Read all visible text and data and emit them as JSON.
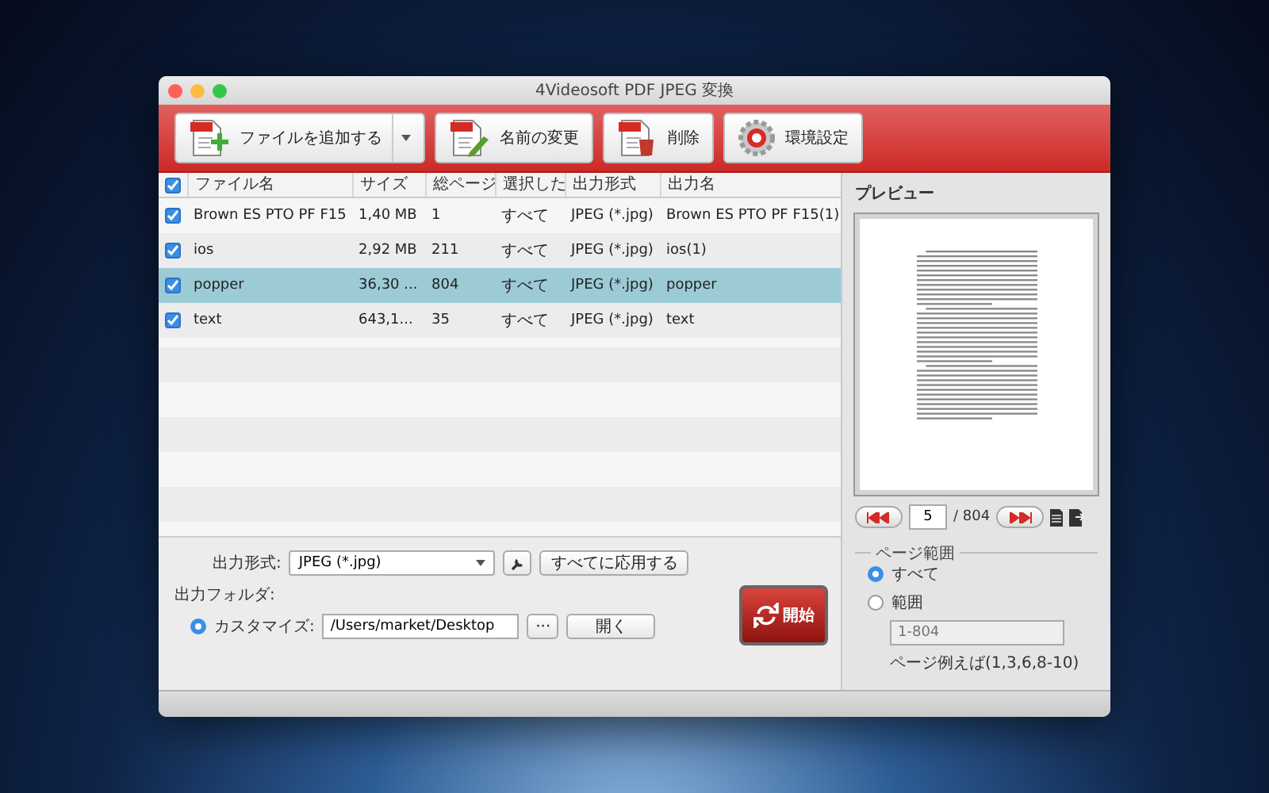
{
  "window": {
    "title": "4Videosoft PDF JPEG 変換"
  },
  "toolbar": [
    {
      "kind": "add",
      "label": "ファイルを追加する",
      "has_dropdown": true
    },
    {
      "kind": "rename",
      "label": "名前の変更",
      "has_dropdown": false
    },
    {
      "kind": "delete",
      "label": "削除",
      "has_dropdown": false
    },
    {
      "kind": "settings",
      "label": "環境設定",
      "has_dropdown": false
    }
  ],
  "table": {
    "all_checked": true,
    "columns": [
      "ファイル名",
      "サイズ",
      "総ページ",
      "選択した",
      "出力形式",
      "出力名"
    ],
    "rows": [
      {
        "checked": true,
        "selected": false,
        "cells": [
          "Brown ES PTO PF F15",
          "1,40 MB",
          "1",
          "すべて",
          "JPEG (*.jpg)",
          "Brown ES PTO PF F15(1)"
        ]
      },
      {
        "checked": true,
        "selected": false,
        "cells": [
          "ios",
          "2,92 MB",
          "211",
          "すべて",
          "JPEG (*.jpg)",
          "ios(1)"
        ]
      },
      {
        "checked": true,
        "selected": true,
        "cells": [
          "popper",
          "36,30 ...",
          "804",
          "すべて",
          "JPEG (*.jpg)",
          "popper"
        ]
      },
      {
        "checked": true,
        "selected": false,
        "cells": [
          "text",
          "643,1...",
          "35",
          "すべて",
          "JPEG (*.jpg)",
          "text"
        ]
      }
    ]
  },
  "output": {
    "format_label": "出力形式:",
    "format": "JPEG (*.jpg)",
    "apply_all": "すべてに応用する",
    "folder_label": "出力フォルダ:",
    "custom": {
      "label": "カスタマイズ:",
      "selected": true
    },
    "path": "/Users/market/Desktop",
    "browse": "···",
    "open": "開く",
    "start": "開始"
  },
  "preview": {
    "title": "プレビュー",
    "page": "5",
    "total": "/ 804",
    "range": {
      "title": "ページ範囲",
      "options": [
        {
          "label": "すべて",
          "selected": true
        },
        {
          "label": "範囲",
          "selected": false
        }
      ],
      "placeholder": "1-804",
      "hint": "ページ例えば(1,3,6,8-10)"
    }
  }
}
